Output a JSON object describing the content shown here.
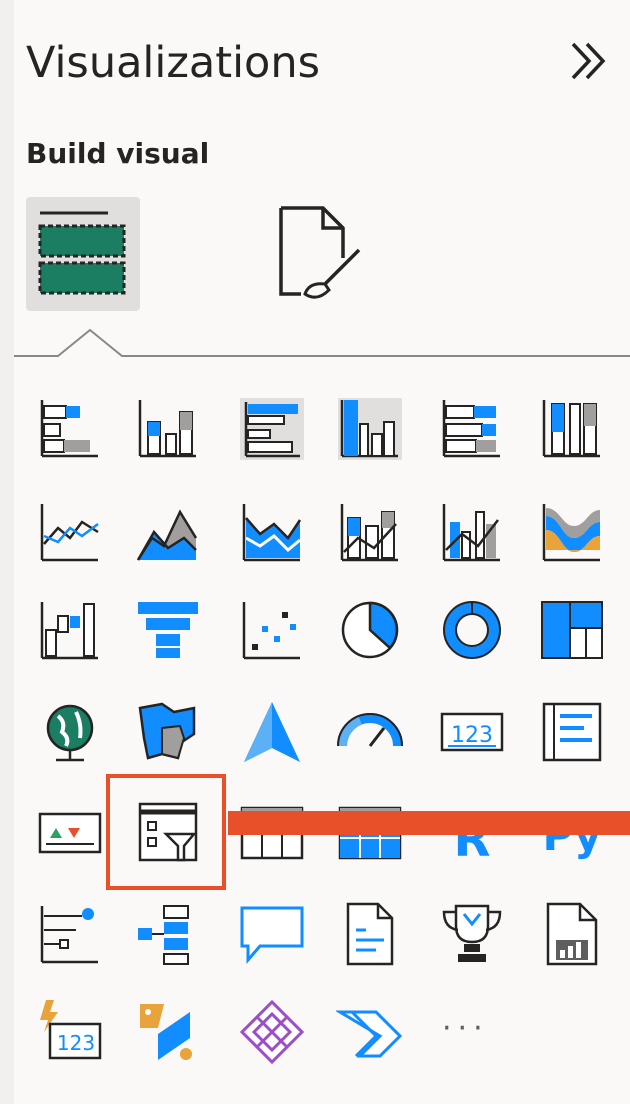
{
  "pane": {
    "title": "Visualizations",
    "section_label": "Build visual",
    "collapse_icon": "chevron-double-right-icon",
    "tabs": [
      {
        "name": "build-visual",
        "icon": "fields-well-icon",
        "selected": true
      },
      {
        "name": "format-visual",
        "icon": "format-paintbrush-icon",
        "selected": false
      }
    ]
  },
  "visuals": [
    [
      "stacked-bar-chart-icon",
      "stacked-column-chart-icon",
      "clustered-bar-chart-icon",
      "clustered-column-chart-icon",
      "100-stacked-bar-chart-icon",
      "100-stacked-column-chart-icon"
    ],
    [
      "line-chart-icon",
      "area-chart-icon",
      "stacked-area-chart-icon",
      "line-and-stacked-column-chart-icon",
      "line-and-clustered-column-chart-icon",
      "ribbon-chart-icon"
    ],
    [
      "waterfall-chart-icon",
      "funnel-chart-icon",
      "scatter-chart-icon",
      "pie-chart-icon",
      "donut-chart-icon",
      "treemap-icon"
    ],
    [
      "map-icon",
      "filled-map-icon",
      "azure-map-icon",
      "gauge-icon",
      "card-icon",
      "multi-row-card-icon"
    ],
    [
      "kpi-icon",
      "slicer-icon",
      "table-icon",
      "matrix-icon",
      "r-script-visual-icon",
      "python-visual-icon"
    ],
    [
      "key-influencers-icon",
      "decomposition-tree-icon",
      "qa-icon",
      "smart-narrative-icon",
      "goals-icon",
      "paginated-report-icon"
    ],
    [
      "power-apps-icon",
      "power-automate-icon",
      "power-bi-app-icon",
      "arcgis-icon",
      "more-visuals-icon"
    ]
  ],
  "more_label": "···",
  "highlighted_visual": "slicer-icon",
  "colors": {
    "accent": "#118dff",
    "highlight": "#e8502a",
    "selected_bg": "#e1dfdd",
    "wells": "#1b7e63"
  }
}
